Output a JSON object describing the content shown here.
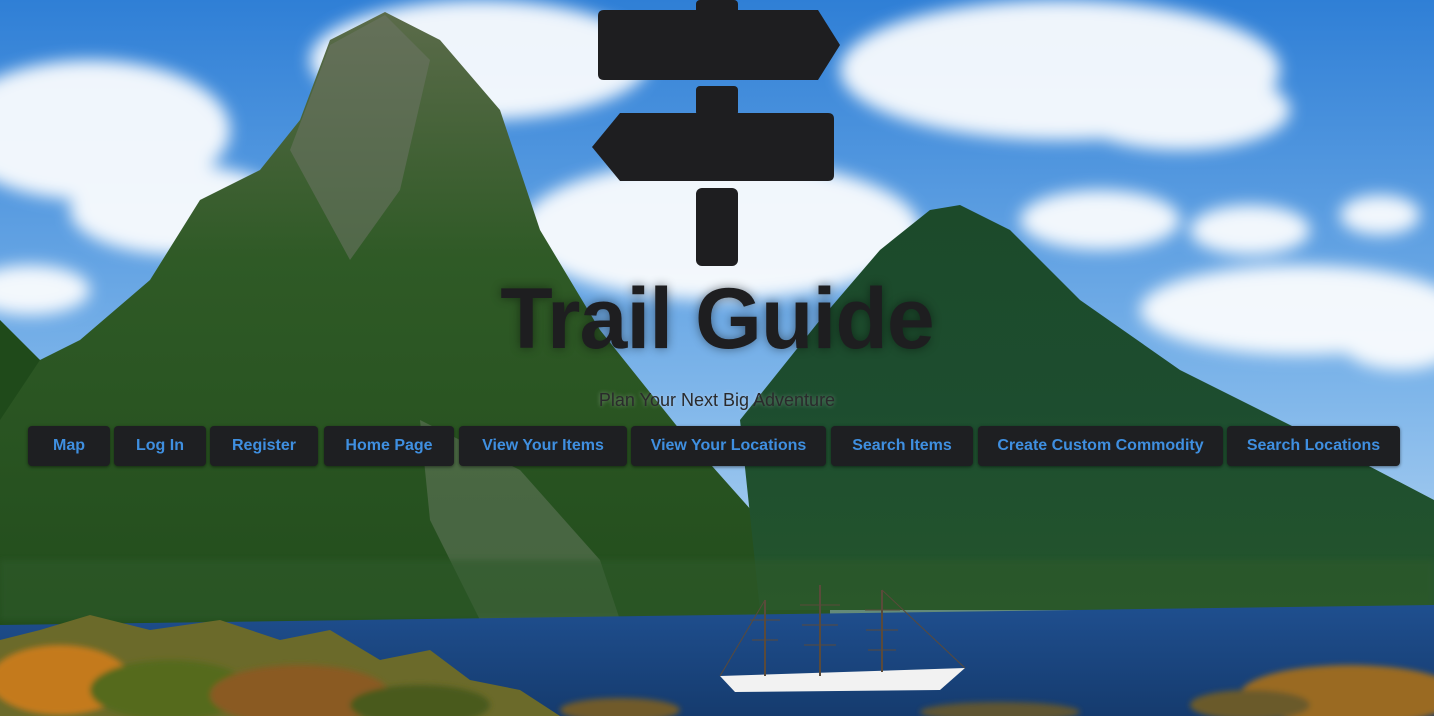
{
  "header": {
    "title": "Trail Guide",
    "tagline": "Plan Your Next Big Adventure",
    "logo_icon": "signpost-icon"
  },
  "nav": {
    "items": [
      {
        "label": "Map"
      },
      {
        "label": "Log In"
      },
      {
        "label": "Register"
      },
      {
        "label": "Home Page"
      },
      {
        "label": "View Your Items"
      },
      {
        "label": "View Your Locations"
      },
      {
        "label": "Search Items"
      },
      {
        "label": "Create Custom Commodity"
      },
      {
        "label": "Search Locations"
      }
    ]
  },
  "colors": {
    "button_bg": "#1e1f22",
    "button_text": "#3f8fe0",
    "title_text": "#1e1e20"
  }
}
